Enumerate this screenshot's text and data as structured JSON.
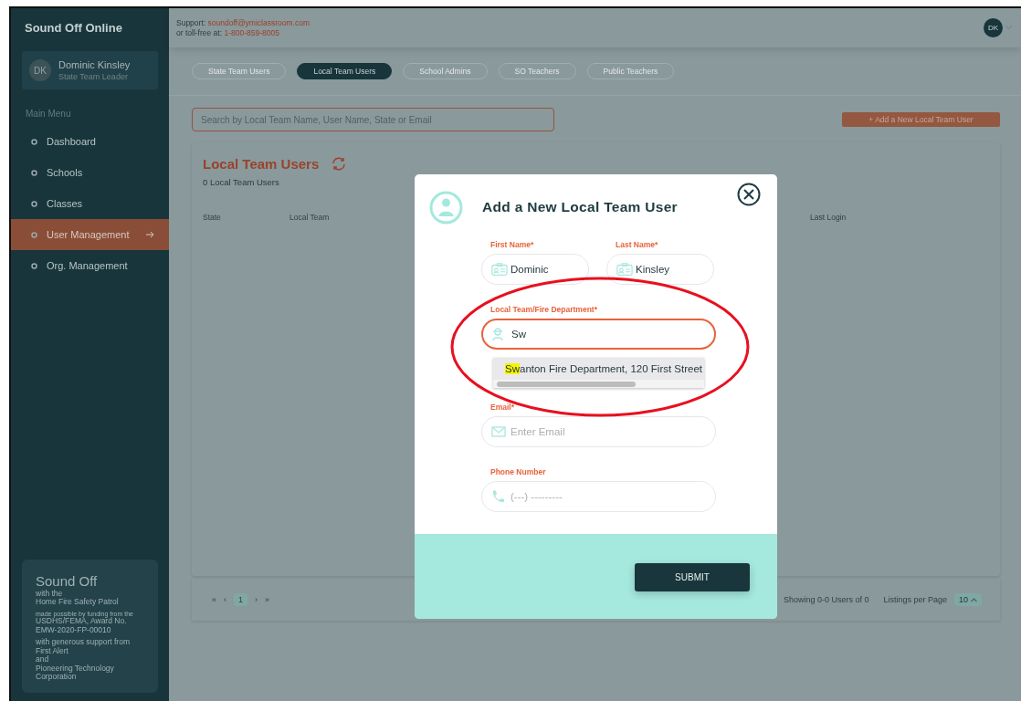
{
  "sidebar": {
    "app_title": "Sound Off Online",
    "user": {
      "initials": "DK",
      "name": "Dominic Kinsley",
      "role": "State Team Leader"
    },
    "menu_heading": "Main Menu",
    "items": [
      {
        "label": "Dashboard",
        "selected": false
      },
      {
        "label": "Schools",
        "selected": false
      },
      {
        "label": "Classes",
        "selected": false
      },
      {
        "label": "User Management",
        "selected": true
      },
      {
        "label": "Org. Management",
        "selected": false
      }
    ],
    "footer": {
      "title": "Sound Off",
      "lines_1": [
        "with the",
        "Home Fire Safety Patrol"
      ],
      "small": "made possible by funding from the",
      "lines_2": [
        "USDHS/FEMA, Award No.",
        "EMW-2020-FP-00010"
      ],
      "lines_3": [
        "with generous support from",
        "First Alert",
        "and",
        "Pioneering Technology Corporation"
      ]
    }
  },
  "header": {
    "support_label": "Support:",
    "support_email": "soundoff@ymiclassroom.com",
    "tollfree_label": "or toll-free at:",
    "tollfree_number": "1-800-859-8005",
    "avatar": "DK"
  },
  "tabs": [
    {
      "label": "State Team Users",
      "selected": false
    },
    {
      "label": "Local Team Users",
      "selected": true
    },
    {
      "label": "School Admins",
      "selected": false
    },
    {
      "label": "SO Teachers",
      "selected": false
    },
    {
      "label": "Public Teachers",
      "selected": false
    }
  ],
  "search": {
    "placeholder": "Search by Local Team Name, User Name, State or Email"
  },
  "add_button": "+ Add a New Local Team User",
  "table": {
    "title": "Local Team Users",
    "count": "0 Local Team Users",
    "columns": [
      "State",
      "Local Team",
      "Last Login"
    ]
  },
  "pagination": {
    "first": "«",
    "prev": "‹",
    "pages": [
      {
        "label": "1",
        "selected": true
      }
    ],
    "next": "›",
    "last": "»",
    "showing": "Showing 0-0 Users of 0",
    "per_page_label": "Listings per Page",
    "per_page": "10"
  },
  "modal": {
    "title": "Add a New Local Team User",
    "first_name": {
      "label": "First Name*",
      "value": "Dominic"
    },
    "last_name": {
      "label": "Last Name*",
      "value": "Kinsley"
    },
    "local_team": {
      "label": "Local Team/Fire Department*",
      "value": "Sw",
      "focused": true
    },
    "suggestions": [
      {
        "match": "Sw",
        "rest": "anton Fire Department, 120 First Street"
      }
    ],
    "email": {
      "label": "Email*",
      "placeholder": "Enter Email"
    },
    "phone": {
      "label": "Phone Number",
      "placeholder": "(---) ---------"
    },
    "submit": "SUBMIT"
  }
}
